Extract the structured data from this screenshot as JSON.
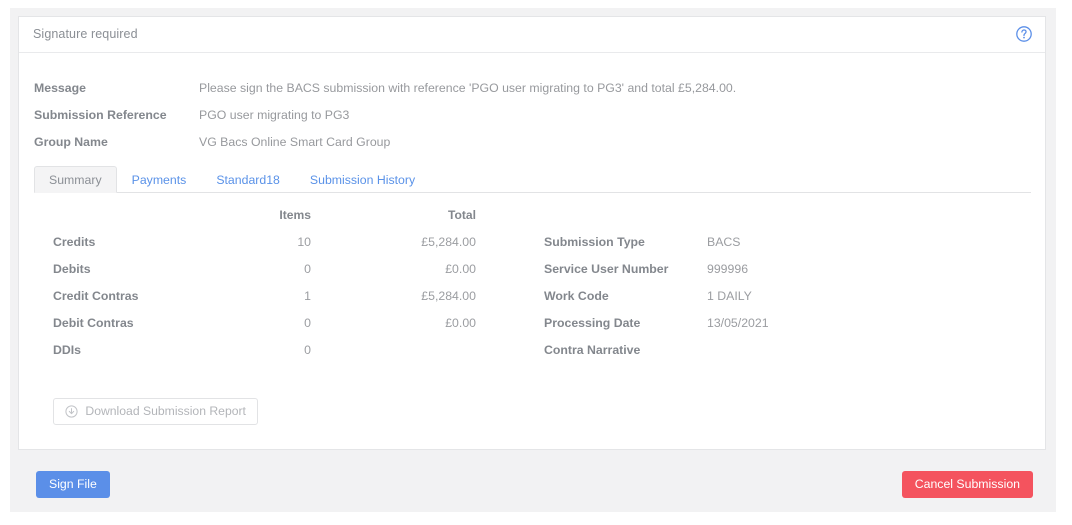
{
  "card": {
    "title": "Signature required",
    "help_icon": "help-circle-icon"
  },
  "meta": [
    {
      "label": "Message",
      "value": "Please sign the BACS submission with reference 'PGO user migrating to PG3' and total £5,284.00."
    },
    {
      "label": "Submission Reference",
      "value": "PGO user migrating to PG3"
    },
    {
      "label": "Group Name",
      "value": "VG Bacs Online Smart Card Group"
    }
  ],
  "tabs": [
    {
      "label": "Summary",
      "active": true
    },
    {
      "label": "Payments",
      "active": false
    },
    {
      "label": "Standard18",
      "active": false
    },
    {
      "label": "Submission History",
      "active": false
    }
  ],
  "summary": {
    "headers": {
      "items": "Items",
      "total": "Total"
    },
    "rows": [
      {
        "name": "Credits",
        "items": "10",
        "total": "£5,284.00"
      },
      {
        "name": "Debits",
        "items": "0",
        "total": "£0.00"
      },
      {
        "name": "Credit Contras",
        "items": "1",
        "total": "£5,284.00"
      },
      {
        "name": "Debit Contras",
        "items": "0",
        "total": "£0.00"
      },
      {
        "name": "DDIs",
        "items": "0",
        "total": ""
      }
    ]
  },
  "details": [
    {
      "label": "Submission Type",
      "value": "BACS"
    },
    {
      "label": "Service User Number",
      "value": "999996"
    },
    {
      "label": "Work Code",
      "value": "1 DAILY"
    },
    {
      "label": "Processing Date",
      "value": "13/05/2021"
    },
    {
      "label": "Contra Narrative",
      "value": ""
    }
  ],
  "download": {
    "label": "Download Submission Report",
    "icon": "download-circle-icon"
  },
  "footer": {
    "sign_label": "Sign File",
    "cancel_label": "Cancel Submission"
  },
  "colors": {
    "primary": "#5b8fe8",
    "danger": "#f4535e",
    "link": "#5a92e8",
    "page_bg": "#f2f2f3",
    "card_bg": "#ffffff"
  }
}
